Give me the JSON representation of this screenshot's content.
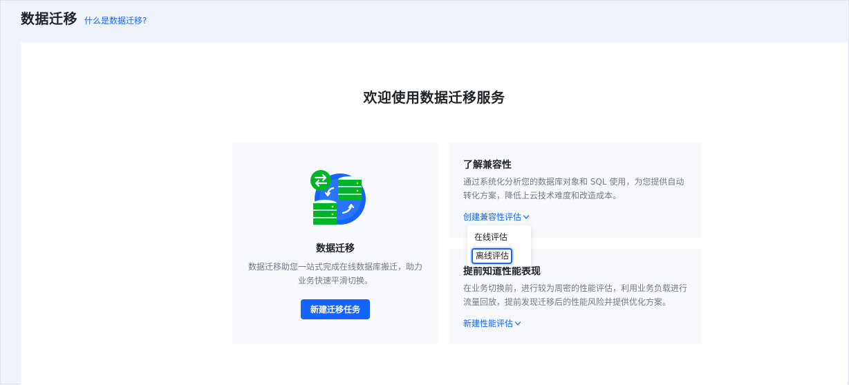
{
  "header": {
    "title": "数据迁移",
    "help_link": "什么是数据迁移?"
  },
  "welcome": {
    "title": "欢迎使用数据迁移服务"
  },
  "migration_card": {
    "title": "数据迁移",
    "description": "数据迁移助您一站式完成在线数据库搬迁，助力业务快速平滑切换。",
    "button_label": "新建迁移任务"
  },
  "compat_card": {
    "title": "了解兼容性",
    "description": "通过系统化分析您的数据库对象和 SQL 使用，为您提供自动转化方案，降低上云技术难度和改造成本。",
    "link_label": "创建兼容性评估"
  },
  "perf_card": {
    "title": "提前知道性能表现",
    "description": "在业务切换前，进行较为周密的性能评估，利用业务负载进行流量回放，提前发现迁移后的性能风险并提供优化方案。",
    "link_label": "新建性能评估"
  },
  "dropdown": {
    "items": [
      {
        "label": "在线评估"
      },
      {
        "label": "离线评估"
      }
    ]
  },
  "colors": {
    "accent": "#1664ff",
    "illustration_green": "#00b42a"
  },
  "icons": {
    "illustration": "database-migration-illustration",
    "link_chevron": "chevron-down-icon"
  }
}
